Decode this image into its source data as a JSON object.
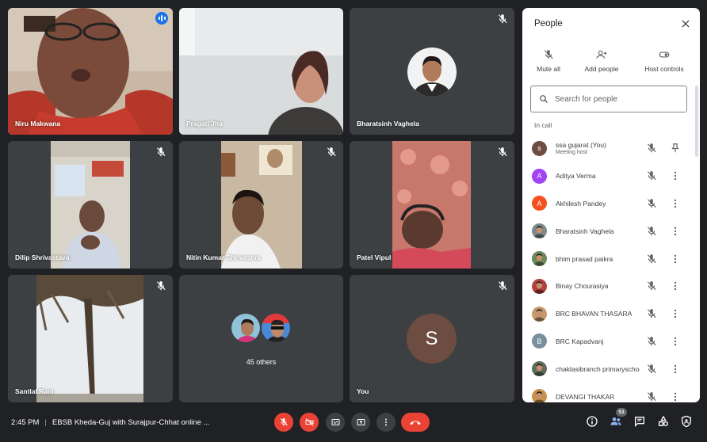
{
  "tiles": [
    {
      "name": "Niru Makwana"
    },
    {
      "name": "Pragati Jha"
    },
    {
      "name": "Bharatsinh Vaghela"
    },
    {
      "name": "Dilip Shrivastava"
    },
    {
      "name": "Nitin Kumar Shrivastva"
    },
    {
      "name": "Patel Vipul"
    },
    {
      "name": "Santlal Ram"
    },
    {
      "name": "45 others"
    },
    {
      "name": "You",
      "initial": "S"
    }
  ],
  "panel": {
    "title": "People",
    "controls": [
      {
        "label": "Mute all",
        "icon": "mic-off-icon"
      },
      {
        "label": "Add people",
        "icon": "person-add-icon"
      },
      {
        "label": "Host controls",
        "icon": "toggle-icon"
      }
    ],
    "search_placeholder": "Search for people",
    "section_label": "In call",
    "participants": [
      {
        "name": "ssa gujarat (You)",
        "sub": "Meeting host",
        "initial": "s",
        "color": "#6d4c41",
        "photo": false
      },
      {
        "name": "Aditya Verma",
        "initial": "A",
        "color": "#a142f4",
        "photo": false
      },
      {
        "name": "Akhilesh Pandey",
        "initial": "A",
        "color": "#f4511e",
        "photo": false
      },
      {
        "name": "Bharatsinh Vaghela",
        "initial": "",
        "color": "#7b8a8b",
        "photo": true
      },
      {
        "name": "bhim prasad paikra",
        "initial": "",
        "color": "#6a8a5a",
        "photo": true
      },
      {
        "name": "Binay Chourasiya",
        "initial": "",
        "color": "#b0413e",
        "photo": true
      },
      {
        "name": "BRC BHAVAN THASARA",
        "initial": "",
        "color": "#c49a6c",
        "photo": true
      },
      {
        "name": "BRC Kapadvanj",
        "initial": "B",
        "color": "#78909c",
        "photo": false
      },
      {
        "name": "chaklasibranch primaryschool",
        "initial": "",
        "color": "#5d6d5a",
        "photo": true
      },
      {
        "name": "DEVANGI THAKAR",
        "initial": "",
        "color": "#c7924d",
        "photo": true
      }
    ]
  },
  "bottom": {
    "time": "2:45 PM",
    "separator": "|",
    "meeting_title": "EBSB Kheda-Guj with Surajpur-Chhat online ...",
    "participant_count": "53"
  }
}
